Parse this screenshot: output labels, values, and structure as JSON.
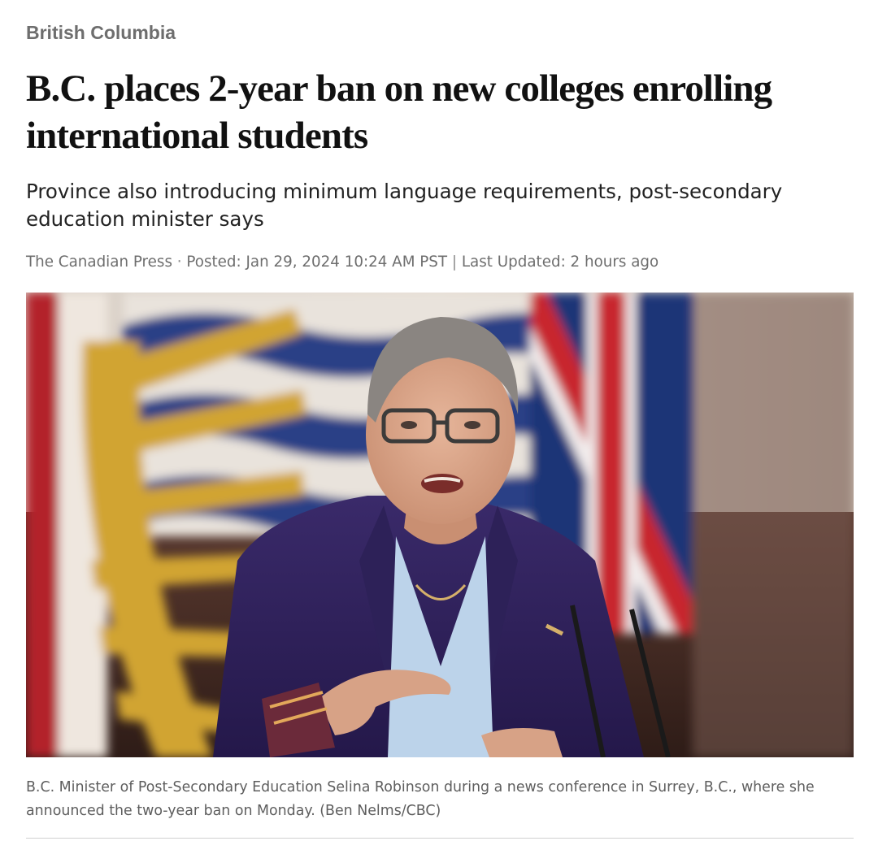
{
  "section": {
    "label": "British Columbia"
  },
  "article": {
    "headline": "B.C. places 2-year ban on new colleges enrolling international students",
    "deck": "Province also introducing minimum language requirements, post-secondary education minister says",
    "byline": {
      "author": "The Canadian Press",
      "posted": "Posted: Jan 29, 2024 10:24 AM PST",
      "updated": "Last Updated: 2 hours ago"
    },
    "image": {
      "caption": "B.C. Minister of Post-Secondary Education Selina Robinson during a news conference in Surrey, B.C., where she announced the two-year ban on Monday. (Ben Nelms/CBC)"
    }
  },
  "colors": {
    "section": "#6e6e6e",
    "headline": "#111111",
    "body_text": "#222222",
    "meta_text": "#6e6e6e",
    "caption_text": "#5e5e5e",
    "divider": "#d0d0d0"
  }
}
